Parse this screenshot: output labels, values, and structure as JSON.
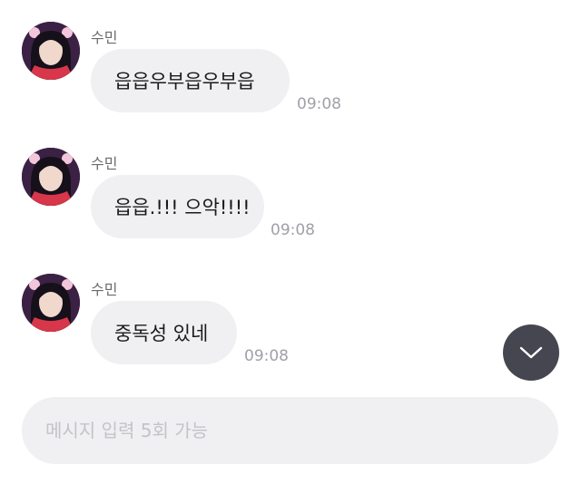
{
  "messages": [
    {
      "sender": "수민",
      "text": "읍읍우부읍우부읍",
      "time": "09:08"
    },
    {
      "sender": "수민",
      "text": "읍읍.!!! 으악!!!!",
      "time": "09:08"
    },
    {
      "sender": "수민",
      "text": "중독성 있네",
      "time": "09:08"
    }
  ],
  "composer": {
    "placeholder": "메시지 입력 5회 가능"
  },
  "icons": {
    "scroll_down": "chevron-down-icon",
    "avatar": "avatar"
  },
  "colors": {
    "bubble": "#f0f0f3",
    "scroll_button": "#45464f",
    "timestamp": "#a0a0a8"
  }
}
